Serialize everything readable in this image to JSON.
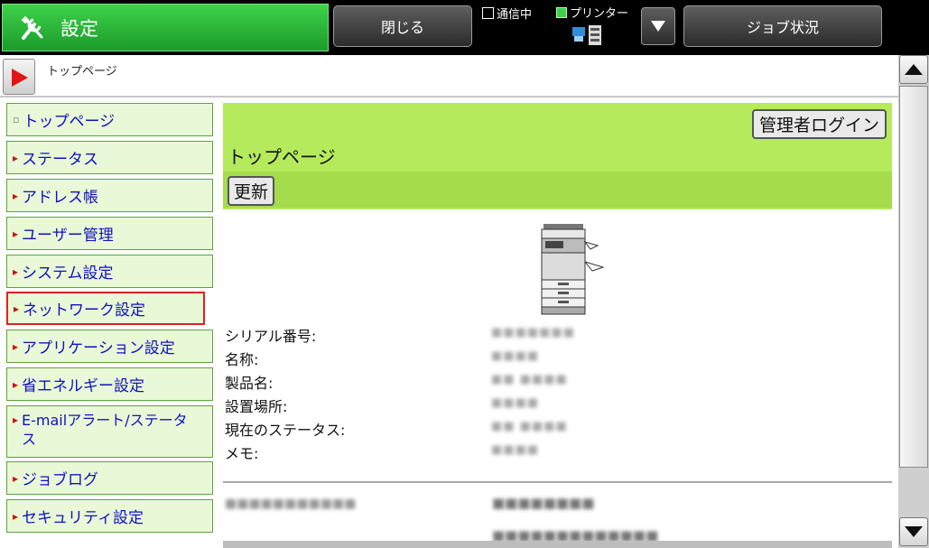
{
  "header": {
    "app_title": "設定",
    "close_label": "閉じる",
    "job_status_label": "ジョブ状況",
    "comm_status": "通信中",
    "printer_status": "プリンター",
    "accent_color": "#2bb63a"
  },
  "breadcrumb": {
    "text": "トップページ"
  },
  "sidebar": {
    "items": [
      {
        "label": "トップページ",
        "marker": "▫"
      },
      {
        "label": "ステータス",
        "marker": "▸"
      },
      {
        "label": "アドレス帳",
        "marker": "▸"
      },
      {
        "label": "ユーザー管理",
        "marker": "▸"
      },
      {
        "label": "システム設定",
        "marker": "▸"
      },
      {
        "label": "ネットワーク設定",
        "marker": "▸"
      },
      {
        "label": "アプリケーション設定",
        "marker": "▸"
      },
      {
        "label": "省エネルギー設定",
        "marker": "▸"
      },
      {
        "label": "E-mailアラート/ステータス",
        "marker": "▸"
      },
      {
        "label": "ジョブログ",
        "marker": "▸"
      },
      {
        "label": "セキュリティ設定",
        "marker": "▸"
      }
    ],
    "selected_index": 5
  },
  "main": {
    "admin_login_label": "管理者ログイン",
    "page_title": "トップページ",
    "refresh_label": "更新",
    "info_rows": [
      {
        "label": "シリアル番号:",
        "value": "■■■■■■■"
      },
      {
        "label": "名称:",
        "value": "■■■■"
      },
      {
        "label": "製品名:",
        "value": "■■ ■■■■"
      },
      {
        "label": "設置場所:",
        "value": "■■■■"
      },
      {
        "label": "現在のステータス:",
        "value": "■■ ■■■■"
      },
      {
        "label": "メモ:",
        "value": "■■■■"
      }
    ],
    "extra_label": "■■■■■■■■■■■",
    "extra_value": "■■■■■■■■",
    "extra_value2": "■■■■■■■■■■■■■"
  }
}
